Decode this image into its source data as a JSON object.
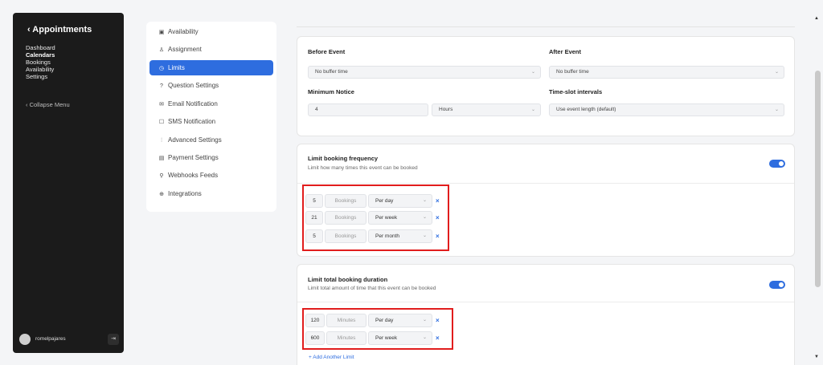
{
  "sidebar": {
    "back_title": "‹ Appointments",
    "nav": [
      "Dashboard",
      "Calendars",
      "Bookings",
      "Availability",
      "Settings"
    ],
    "active_nav": "Calendars",
    "collapse": "‹  Collapse Menu",
    "user": "romelpajares",
    "logout_icon": "⇥"
  },
  "menu": {
    "items": [
      {
        "icon": "▣",
        "label": "Availability"
      },
      {
        "icon": "♙",
        "label": "Assignment"
      },
      {
        "icon": "◷",
        "label": "Limits"
      },
      {
        "icon": "?",
        "label": "Question Settings"
      },
      {
        "icon": "✉",
        "label": "Email Notification"
      },
      {
        "icon": "☐",
        "label": "SMS Notification"
      },
      {
        "icon": "⫶",
        "label": "Advanced Settings"
      },
      {
        "icon": "▤",
        "label": "Payment Settings"
      },
      {
        "icon": "⚲",
        "label": "Webhooks Feeds"
      },
      {
        "icon": "⊕",
        "label": "Integrations"
      }
    ],
    "active": "Limits"
  },
  "buffers": {
    "before_label": "Before Event",
    "before_value": "No buffer time",
    "after_label": "After Event",
    "after_value": "No buffer time",
    "notice_label": "Minimum Notice",
    "notice_value": "4",
    "notice_unit": "Hours",
    "interval_label": "Time-slot intervals",
    "interval_value": "Use event length (default)"
  },
  "frequency": {
    "title": "Limit booking frequency",
    "subtitle": "Limit how many times this event can be booked",
    "enabled": true,
    "rows": [
      {
        "value": "5",
        "unit": "Bookings",
        "period": "Per day"
      },
      {
        "value": "21",
        "unit": "Bookings",
        "period": "Per week"
      },
      {
        "value": "5",
        "unit": "Bookings",
        "period": "Per month"
      }
    ]
  },
  "duration": {
    "title": "Limit total booking duration",
    "subtitle": "Limit total amount of time that this event can be booked",
    "enabled": true,
    "rows": [
      {
        "value": "120",
        "unit": "Minutes",
        "period": "Per day"
      },
      {
        "value": "600",
        "unit": "Minutes",
        "period": "Per week"
      }
    ],
    "add_link": "+ Add Another Limit"
  },
  "icons": {
    "chevron": "⌄",
    "remove": "×",
    "scroll_up": "▲",
    "scroll_down": "▼"
  },
  "colors": {
    "accent": "#2e6ddf",
    "highlight": "#e11d1d",
    "sidebar_bg": "#1b1b1b"
  }
}
